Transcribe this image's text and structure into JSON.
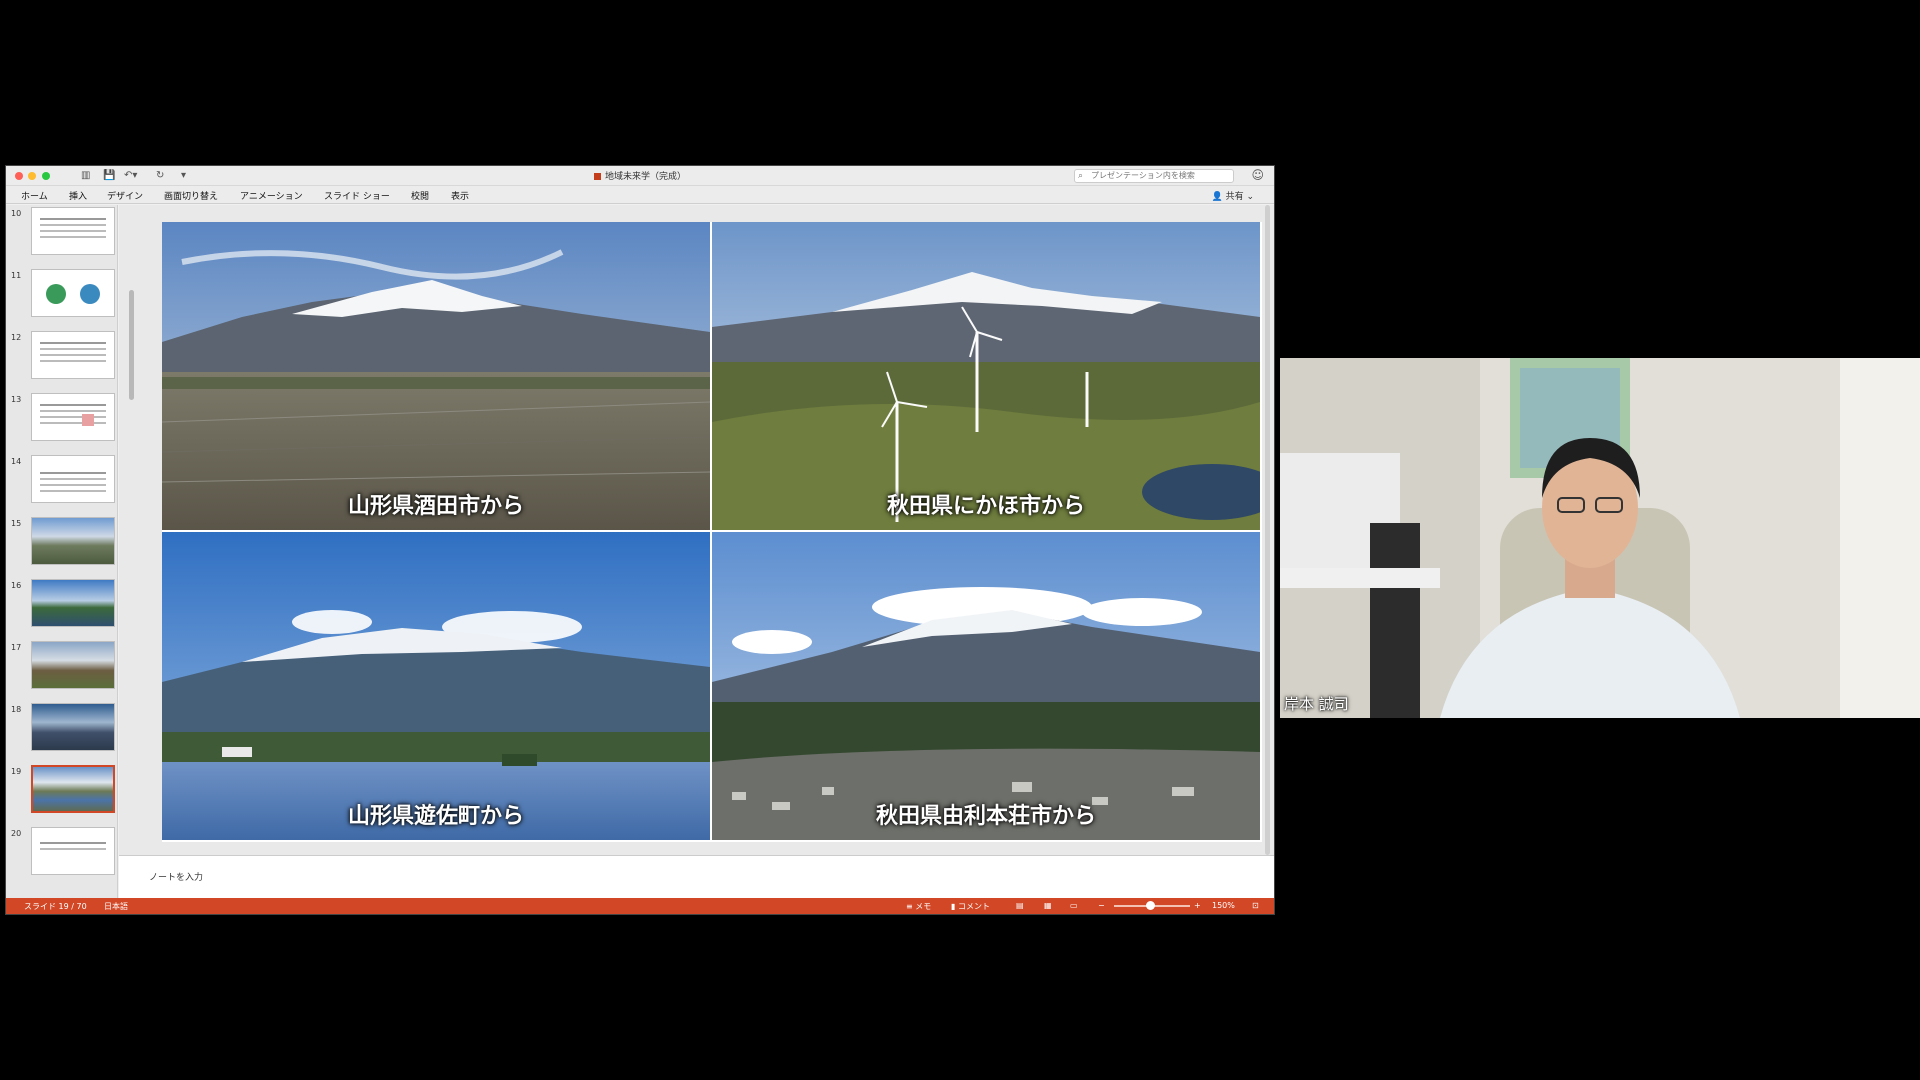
{
  "window": {
    "title": "地域未来学（完成）",
    "search_placeholder": "プレゼンテーション内を検索",
    "share_label": "共有"
  },
  "menu": [
    "ホーム",
    "挿入",
    "デザイン",
    "画面切り替え",
    "アニメーション",
    "スライド ショー",
    "校閲",
    "表示"
  ],
  "thumbnails": [
    {
      "num": "10"
    },
    {
      "num": "11"
    },
    {
      "num": "12"
    },
    {
      "num": "13"
    },
    {
      "num": "14"
    },
    {
      "num": "15"
    },
    {
      "num": "16"
    },
    {
      "num": "17"
    },
    {
      "num": "18"
    },
    {
      "num": "19"
    },
    {
      "num": "20"
    }
  ],
  "selected_slide": "19",
  "slide": {
    "captions": [
      "山形県酒田市から",
      "秋田県にかほ市から",
      "山形県遊佐町から",
      "秋田県由利本荘市から"
    ]
  },
  "notes_placeholder": "ノートを入力",
  "status": {
    "slide_position": "スライド 19 / 70",
    "language": "日本語",
    "memo": "メモ",
    "comment": "コメント",
    "zoom": "150%"
  },
  "video": {
    "participant_name": "岸本 誠司"
  },
  "colors": {
    "accent": "#d24726",
    "background": "#000000"
  }
}
